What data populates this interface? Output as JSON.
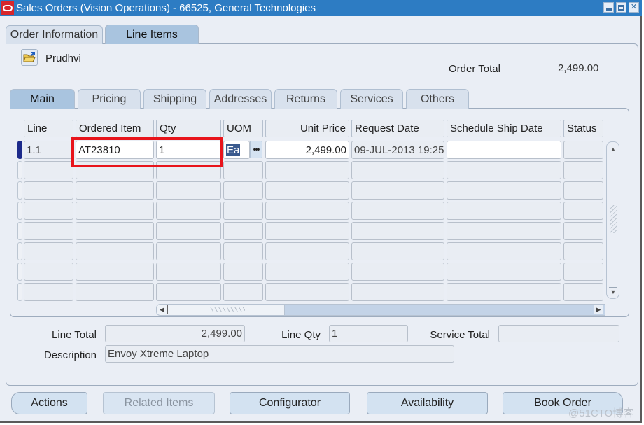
{
  "window": {
    "title": "Sales Orders (Vision Operations) - 66525, General Technologies",
    "controls": [
      "minimize",
      "maximize",
      "close"
    ],
    "close_glyph": "✕"
  },
  "top_tabs": [
    {
      "label": "Order Information",
      "active": false
    },
    {
      "label": "Line Items",
      "active": true
    }
  ],
  "header": {
    "folder_icon": "open-folder-icon",
    "user_name": "Prudhvi",
    "order_total_label": "Order Total",
    "order_total_value": "2,499.00"
  },
  "sub_tabs": [
    {
      "label": "Main",
      "active": true
    },
    {
      "label": "Pricing",
      "active": false
    },
    {
      "label": "Shipping",
      "active": false
    },
    {
      "label": "Addresses",
      "active": false
    },
    {
      "label": "Returns",
      "active": false
    },
    {
      "label": "Services",
      "active": false
    },
    {
      "label": "Others",
      "active": false
    }
  ],
  "grid": {
    "columns": [
      "Line",
      "Ordered Item",
      "Qty",
      "UOM",
      "Unit Price",
      "Request Date",
      "Schedule Ship Date",
      "Status"
    ],
    "rows": [
      {
        "line": "1.1",
        "ordered_item": "AT23810",
        "qty": "1",
        "uom": "Ea",
        "unit_price": "2,499.00",
        "request_date": "09-JUL-2013 19:25",
        "schedule_ship_date": "",
        "status": ""
      }
    ],
    "empty_row_count": 7,
    "lov_glyph": "•••",
    "highlighted_fields": [
      "Ordered Item",
      "Qty"
    ]
  },
  "scrollbars": {
    "up_glyph": "▲",
    "down_glyph": "▼",
    "left_glyph": "◀",
    "right_glyph": "▶"
  },
  "footer": {
    "line_total_label": "Line Total",
    "line_total_value": "2,499.00",
    "line_qty_label": "Line Qty",
    "line_qty_value": "1",
    "service_total_label": "Service Total",
    "service_total_value": "",
    "description_label": "Description",
    "description_value": "Envoy Xtreme Laptop"
  },
  "buttons": [
    {
      "label": "Actions",
      "mnemonic": "A",
      "rest": "ctions",
      "enabled": true
    },
    {
      "label": "Related Items",
      "mnemonic": "R",
      "rest": "elated Items",
      "enabled": false
    },
    {
      "label": "Configurator",
      "pre": "Co",
      "mnemonic": "n",
      "rest": "figurator",
      "enabled": true
    },
    {
      "label": "Availability",
      "pre": "Avai",
      "mnemonic": "l",
      "rest": "ability",
      "enabled": true
    },
    {
      "label": "Book Order",
      "mnemonic": "B",
      "rest": "ook Order",
      "enabled": true
    }
  ],
  "watermark": "@51CTO博客",
  "colors": {
    "titlebar": "#2d7cc3",
    "active_tab": "#a9c4df",
    "highlight_border": "#e8141b",
    "current_row_indicator": "#1c2a8a"
  }
}
